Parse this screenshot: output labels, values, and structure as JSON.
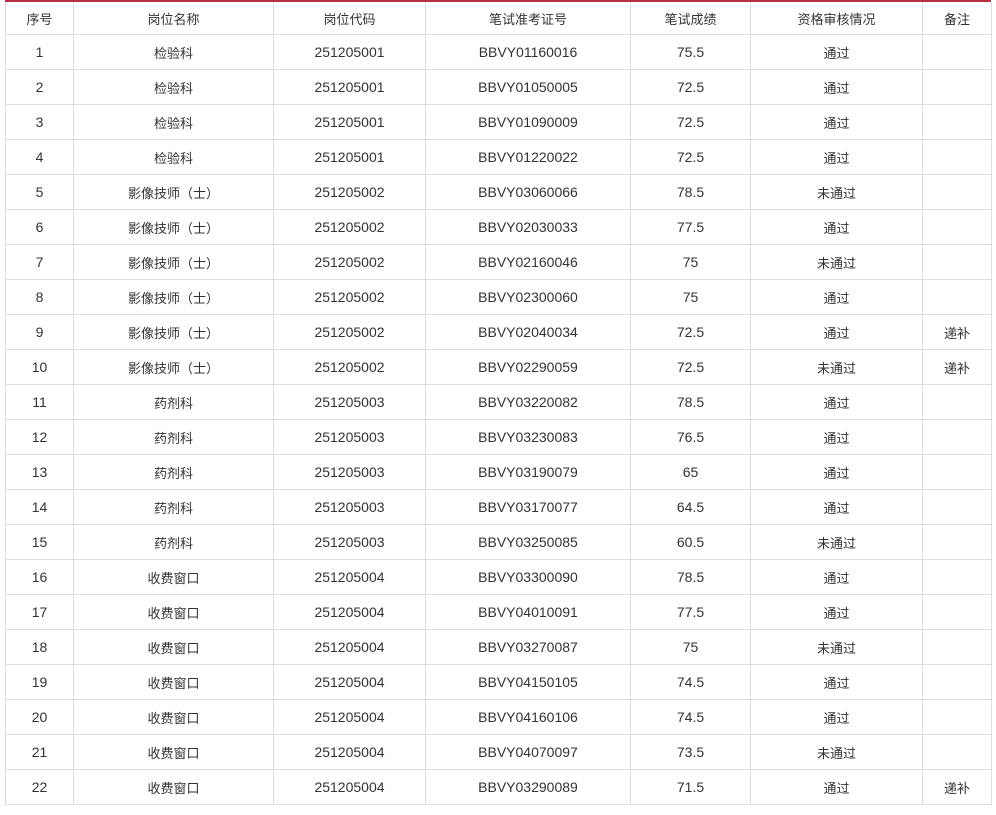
{
  "headers": [
    "序号",
    "岗位名称",
    "岗位代码",
    "笔试准考证号",
    "笔试成绩",
    "资格审核情况",
    "备注"
  ],
  "rows": [
    {
      "no": "1",
      "post": "检验科",
      "code": "251205001",
      "ticket": "BBVY01160016",
      "score": "75.5",
      "review": "通过",
      "note": ""
    },
    {
      "no": "2",
      "post": "检验科",
      "code": "251205001",
      "ticket": "BBVY01050005",
      "score": "72.5",
      "review": "通过",
      "note": ""
    },
    {
      "no": "3",
      "post": "检验科",
      "code": "251205001",
      "ticket": "BBVY01090009",
      "score": "72.5",
      "review": "通过",
      "note": ""
    },
    {
      "no": "4",
      "post": "检验科",
      "code": "251205001",
      "ticket": "BBVY01220022",
      "score": "72.5",
      "review": "通过",
      "note": ""
    },
    {
      "no": "5",
      "post": "影像技师（士）",
      "code": "251205002",
      "ticket": "BBVY03060066",
      "score": "78.5",
      "review": "未通过",
      "note": ""
    },
    {
      "no": "6",
      "post": "影像技师（士）",
      "code": "251205002",
      "ticket": "BBVY02030033",
      "score": "77.5",
      "review": "通过",
      "note": ""
    },
    {
      "no": "7",
      "post": "影像技师（士）",
      "code": "251205002",
      "ticket": "BBVY02160046",
      "score": "75",
      "review": "未通过",
      "note": ""
    },
    {
      "no": "8",
      "post": "影像技师（士）",
      "code": "251205002",
      "ticket": "BBVY02300060",
      "score": "75",
      "review": "通过",
      "note": ""
    },
    {
      "no": "9",
      "post": "影像技师（士）",
      "code": "251205002",
      "ticket": "BBVY02040034",
      "score": "72.5",
      "review": "通过",
      "note": "递补"
    },
    {
      "no": "10",
      "post": "影像技师（士）",
      "code": "251205002",
      "ticket": "BBVY02290059",
      "score": "72.5",
      "review": "未通过",
      "note": "递补"
    },
    {
      "no": "11",
      "post": "药剂科",
      "code": "251205003",
      "ticket": "BBVY03220082",
      "score": "78.5",
      "review": "通过",
      "note": ""
    },
    {
      "no": "12",
      "post": "药剂科",
      "code": "251205003",
      "ticket": "BBVY03230083",
      "score": "76.5",
      "review": "通过",
      "note": ""
    },
    {
      "no": "13",
      "post": "药剂科",
      "code": "251205003",
      "ticket": "BBVY03190079",
      "score": "65",
      "review": "通过",
      "note": ""
    },
    {
      "no": "14",
      "post": "药剂科",
      "code": "251205003",
      "ticket": "BBVY03170077",
      "score": "64.5",
      "review": "通过",
      "note": ""
    },
    {
      "no": "15",
      "post": "药剂科",
      "code": "251205003",
      "ticket": "BBVY03250085",
      "score": "60.5",
      "review": "未通过",
      "note": ""
    },
    {
      "no": "16",
      "post": "收费窗口",
      "code": "251205004",
      "ticket": "BBVY03300090",
      "score": "78.5",
      "review": "通过",
      "note": ""
    },
    {
      "no": "17",
      "post": "收费窗口",
      "code": "251205004",
      "ticket": "BBVY04010091",
      "score": "77.5",
      "review": "通过",
      "note": ""
    },
    {
      "no": "18",
      "post": "收费窗口",
      "code": "251205004",
      "ticket": "BBVY03270087",
      "score": "75",
      "review": "未通过",
      "note": ""
    },
    {
      "no": "19",
      "post": "收费窗口",
      "code": "251205004",
      "ticket": "BBVY04150105",
      "score": "74.5",
      "review": "通过",
      "note": ""
    },
    {
      "no": "20",
      "post": "收费窗口",
      "code": "251205004",
      "ticket": "BBVY04160106",
      "score": "74.5",
      "review": "通过",
      "note": ""
    },
    {
      "no": "21",
      "post": "收费窗口",
      "code": "251205004",
      "ticket": "BBVY04070097",
      "score": "73.5",
      "review": "未通过",
      "note": ""
    },
    {
      "no": "22",
      "post": "收费窗口",
      "code": "251205004",
      "ticket": "BBVY03290089",
      "score": "71.5",
      "review": "通过",
      "note": "递补"
    }
  ],
  "colors": {
    "accent_line": "#b8303f",
    "border": "#dedede",
    "text": "#333333"
  }
}
